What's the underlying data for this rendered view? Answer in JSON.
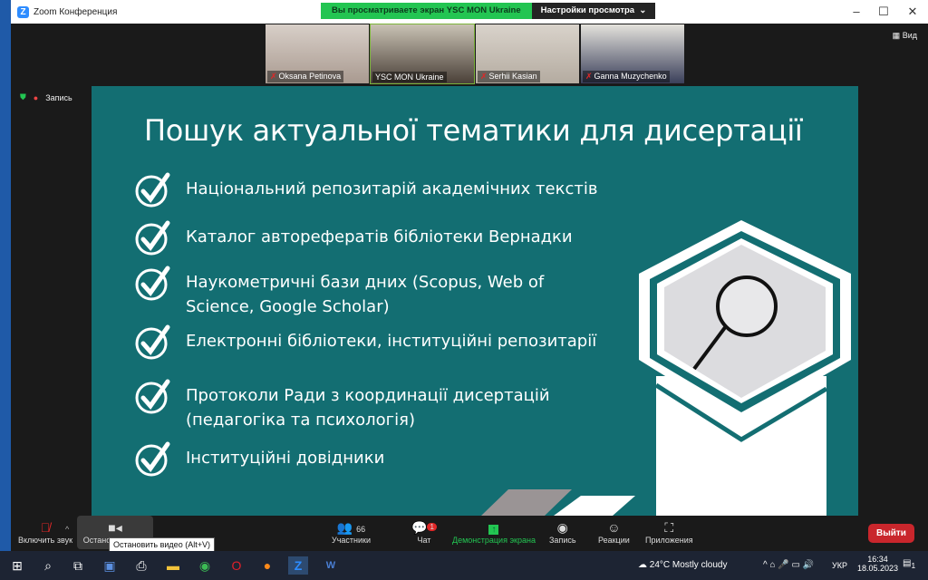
{
  "window": {
    "title": "Zoom Конференция",
    "minimize": "‒",
    "maximize": "☐",
    "close": "✕"
  },
  "share_banner": {
    "text": "Вы просматриваете экран YSC MON Ukraine",
    "settings": "Настройки просмотра",
    "chevron": "⌄"
  },
  "view_button": "Вид",
  "recording_label": "Запись",
  "participants": [
    {
      "name": "Oksana Petinova",
      "muted": true
    },
    {
      "name": "YSC MON Ukraine",
      "muted": false
    },
    {
      "name": "Serhii Kasian",
      "muted": true
    },
    {
      "name": "Ganna Muzychenko",
      "muted": true
    }
  ],
  "slide": {
    "title": "Пошук актуальної тематики для  дисертації",
    "items": [
      "Національний репозитарій академічних текстів",
      "Каталог авторефератів бібліотеки Вернадки",
      "Наукометричні бази дних (Scopus, Web of Science, Google Scholar)",
      "Електронні бібліотеки, інституційні репозитарії",
      "Протоколи Ради з координації  дисертацій (педагогіка та психологія)",
      "Інституційні довідники"
    ]
  },
  "toolbar": {
    "unmute": "Включить звук",
    "video": "Остано",
    "participants": "Участники",
    "participants_count": "66",
    "chat": "Чат",
    "chat_badge": "1",
    "share": "Демонстрация экрана",
    "record": "Запись",
    "reactions": "Реакции",
    "apps": "Приложения",
    "leave": "Выйти"
  },
  "tooltip": "Остановить видео (Alt+V)",
  "taskbar": {
    "weather": "24°C  Mostly cloudy",
    "lang": "УКР",
    "time": "16:34",
    "date": "18.05.2023",
    "notif": "1"
  },
  "colors": {
    "slide_bg": "#136e72",
    "share_green": "#23c552",
    "leave_red": "#c9262c"
  }
}
